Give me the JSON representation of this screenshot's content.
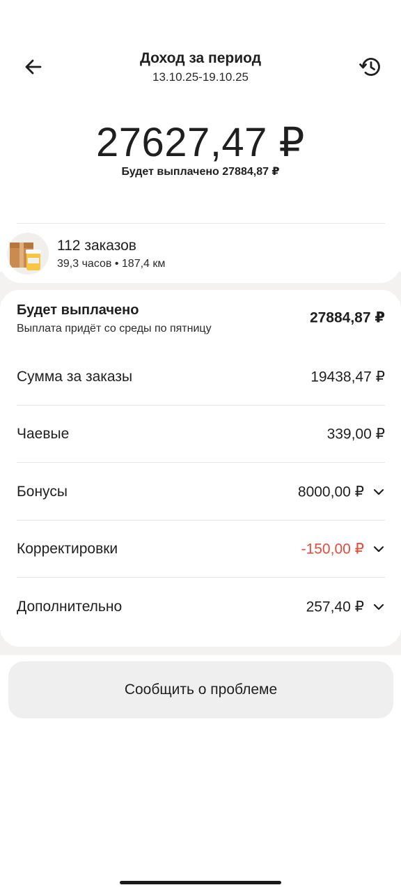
{
  "header": {
    "title": "Доход за период",
    "period": "13.10.25-19.10.25",
    "back_icon": "arrow-left-icon",
    "history_icon": "history-icon"
  },
  "summary": {
    "amount": "27627,47 ₽",
    "payout_text": "Будет выплачено 27884,87 ₽"
  },
  "orders": {
    "count": "112 заказов",
    "meta": "39,3 часов • 187,4 км",
    "icon": "parcel-and-cup-icon"
  },
  "breakdown": {
    "payout": {
      "label": "Будет выплачено",
      "sub": "Выплата придёт со среды по пятницу",
      "value": "27884,87 ₽"
    },
    "rows": [
      {
        "label": "Сумма за заказы",
        "value": "19438,47 ₽"
      },
      {
        "label": "Чаевые",
        "value": "339,00 ₽"
      },
      {
        "label": "Бонусы",
        "value": "8000,00 ₽"
      },
      {
        "label": "Корректировки",
        "value": "-150,00 ₽"
      },
      {
        "label": "Дополнительно",
        "value": "257,40 ₽"
      }
    ]
  },
  "actions": {
    "report_label": "Сообщить о проблеме"
  },
  "colors": {
    "negative": "#e64a3b",
    "background_gray": "#f3f2f0",
    "button_gray": "#efefef"
  }
}
